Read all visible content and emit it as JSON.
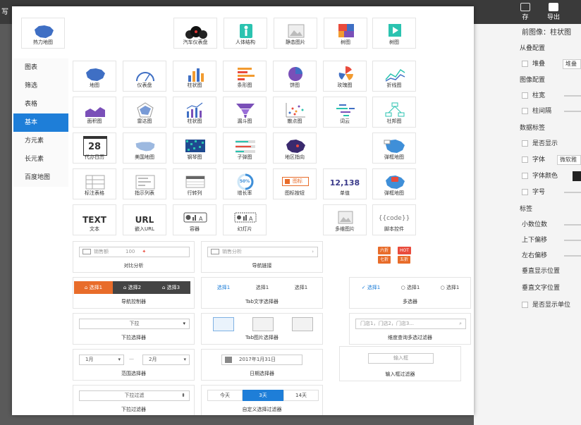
{
  "topbar": {
    "app_title": "写",
    "tools": [
      {
        "label": "存",
        "icon": "save-icon"
      },
      {
        "label": "导出",
        "icon": "export-icon"
      }
    ]
  },
  "right_panel": {
    "header": "前图像：柱状图",
    "items": [
      {
        "text": "从叠配置",
        "kind": "section"
      },
      {
        "text": "堆叠",
        "kind": "checkbox",
        "field": "堆叠"
      },
      {
        "text": "图像配置",
        "kind": "section"
      },
      {
        "text": "柱宽",
        "kind": "checkbox"
      },
      {
        "text": "柱间隔",
        "kind": "checkbox"
      },
      {
        "text": "数据标签",
        "kind": "section"
      },
      {
        "text": "是否显示",
        "kind": "checkbox"
      },
      {
        "text": "字体",
        "kind": "checkbox",
        "field": "微软雅"
      },
      {
        "text": "字体颜色",
        "kind": "checkbox"
      },
      {
        "text": "字号",
        "kind": "checkbox"
      },
      {
        "text": "标签",
        "kind": "section"
      },
      {
        "text": "小数位数",
        "kind": "plain"
      },
      {
        "text": "上下偏移",
        "kind": "plain"
      },
      {
        "text": "左右偏移",
        "kind": "plain"
      },
      {
        "text": "垂直显示位置",
        "kind": "plain"
      },
      {
        "text": "垂直文字位置",
        "kind": "plain"
      },
      {
        "text": "是否显示单位",
        "kind": "checkbox"
      }
    ]
  },
  "modal": {
    "sidebar": [
      "图表",
      "筛选",
      "表格",
      "基本",
      "方元素",
      "长元素",
      "百度地图"
    ],
    "active_sidebar": "基本",
    "top_cards": [
      {
        "label": "热力地图",
        "icon": "china-map-icon"
      },
      {
        "label": "汽车仪表盘",
        "icon": "car-dashboard-icon"
      },
      {
        "label": "人体结构",
        "icon": "human-body-icon"
      },
      {
        "label": "静态图片",
        "icon": "image-icon"
      },
      {
        "label": "树图",
        "icon": "treemap-icon"
      },
      {
        "label": "树图",
        "icon": "play-icon"
      }
    ],
    "grid_cards": [
      {
        "label": "地图",
        "icon": "china-map-icon"
      },
      {
        "label": "仪表盘",
        "icon": "gauge-icon"
      },
      {
        "label": "柱状图",
        "icon": "bar-chart-icon"
      },
      {
        "label": "条形图",
        "icon": "horizontal-bar-icon"
      },
      {
        "label": "饼图",
        "icon": "pie-chart-icon"
      },
      {
        "label": "玫瑰图",
        "icon": "rose-chart-icon"
      },
      {
        "label": "折线图",
        "icon": "line-chart-icon"
      },
      {
        "label": "面积图",
        "icon": "area-chart-icon"
      },
      {
        "label": "雷达图",
        "icon": "radar-chart-icon"
      },
      {
        "label": "柱状图",
        "icon": "bar-line-icon"
      },
      {
        "label": "漏斗图",
        "icon": "funnel-icon"
      },
      {
        "label": "散点图",
        "icon": "scatter-icon"
      },
      {
        "label": "词云",
        "icon": "word-cloud-icon"
      },
      {
        "label": "社邦图",
        "icon": "network-icon"
      },
      {
        "label": "代办日历",
        "icon": "calendar-icon",
        "big": "28"
      },
      {
        "label": "美国地图",
        "icon": "usa-map-icon"
      },
      {
        "label": "钢琴图",
        "icon": "heatmap-icon"
      },
      {
        "label": "子弹图",
        "icon": "bullet-chart-icon"
      },
      {
        "label": "地区指向",
        "icon": "region-map-icon"
      },
      {
        "label": "弹框地图",
        "icon": "popup-map-icon"
      },
      {
        "label": "标注表格",
        "icon": "table-icon"
      },
      {
        "label": "指示列表",
        "icon": "list-icon"
      },
      {
        "label": "行转列",
        "icon": "pivot-icon"
      },
      {
        "label": "增长率",
        "icon": "donut-icon",
        "big": "50%"
      },
      {
        "label": "图标按钮",
        "icon": "icon-button-icon"
      },
      {
        "label": "单值",
        "icon": "number-icon",
        "big": "12,138"
      },
      {
        "label": "弹框地图",
        "icon": "map-pin-icon"
      },
      {
        "label": "文本",
        "icon": "text-icon",
        "big": "TEXT"
      },
      {
        "label": "嵌入URL",
        "icon": "url-icon",
        "big": "URL"
      },
      {
        "label": "容器",
        "icon": "container-icon"
      },
      {
        "label": "幻灯片",
        "icon": "slides-icon"
      },
      {
        "label": "多维图片",
        "icon": "multi-image-icon"
      },
      {
        "label": "脚本控件",
        "icon": "code-icon",
        "big": "{{code}}"
      }
    ],
    "icon_button_text": "图标",
    "components": {
      "compare": {
        "label": "对比分析",
        "placeholder": "销售额",
        "value": "100"
      },
      "nav_link": {
        "label": "导航链接",
        "placeholder": "销售分析"
      },
      "tags": {
        "labels": [
          "六折",
          "HOT",
          "七折",
          "五折"
        ]
      },
      "nav_control": {
        "label": "导航控制器",
        "options": [
          "选择1",
          "选择2",
          "选择3"
        ]
      },
      "tab_text": {
        "label": "Tab文字选择器",
        "options": [
          "选择1",
          "选择1",
          "选择1"
        ]
      },
      "multi": {
        "label": "多选器",
        "options": [
          "选择1",
          "选择1",
          "选择1"
        ]
      },
      "dropdown": {
        "label": "下拉选择器",
        "value": "下拉"
      },
      "tab_image": {
        "label": "Tab图片选择器"
      },
      "dim_query": {
        "label": "维度查询多选过滤器",
        "placeholder": "门店1，门店2，门店3..."
      },
      "range": {
        "label": "范围选择器",
        "from": "1月",
        "sep": "—",
        "to": "2月"
      },
      "date": {
        "label": "日期选择器",
        "value": "2017年1月31日"
      },
      "input_filter": {
        "label": "输入框过滤器",
        "placeholder": "输入框"
      },
      "dropdown_filter": {
        "label": "下拉过滤器",
        "value": "下拉过滤"
      },
      "custom_filter": {
        "label": "自定义选择过滤器",
        "options": [
          "今天",
          "3天",
          "14天"
        ],
        "active": "3天"
      }
    }
  },
  "colors": {
    "accent": "#1e7ed8",
    "orange": "#e86c2a",
    "dark": "#3a3a3a"
  }
}
